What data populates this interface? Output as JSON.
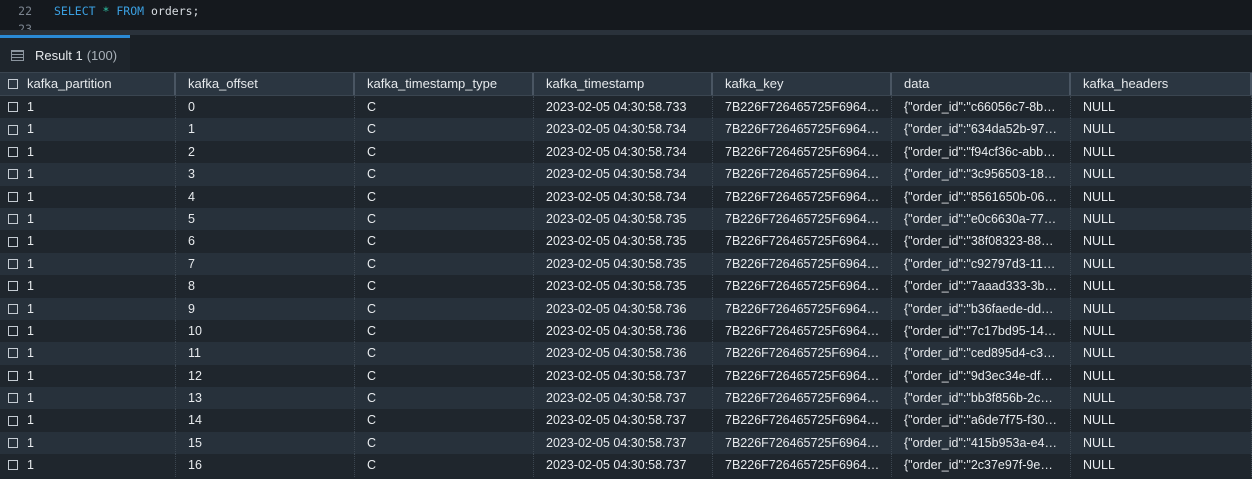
{
  "editor": {
    "lines": [
      {
        "number": "22",
        "tokens": [
          "SELECT",
          "*",
          "FROM",
          "orders;"
        ]
      },
      {
        "number": "23"
      }
    ]
  },
  "result_tab": {
    "label": "Result 1",
    "count": "(100)",
    "icon": "table-icon"
  },
  "grid": {
    "columns": [
      "kafka_partition",
      "kafka_offset",
      "kafka_timestamp_type",
      "kafka_timestamp",
      "kafka_key",
      "data",
      "kafka_headers"
    ],
    "rows": [
      [
        "1",
        "0",
        "C",
        "2023-02-05 04:30:58.733",
        "7B226F726465725F6964…",
        "{\"order_id\":\"c66056c7-8b…",
        "NULL"
      ],
      [
        "1",
        "1",
        "C",
        "2023-02-05 04:30:58.734",
        "7B226F726465725F6964…",
        "{\"order_id\":\"634da52b-97…",
        "NULL"
      ],
      [
        "1",
        "2",
        "C",
        "2023-02-05 04:30:58.734",
        "7B226F726465725F6964…",
        "{\"order_id\":\"f94cf36c-abb…",
        "NULL"
      ],
      [
        "1",
        "3",
        "C",
        "2023-02-05 04:30:58.734",
        "7B226F726465725F6964…",
        "{\"order_id\":\"3c956503-18…",
        "NULL"
      ],
      [
        "1",
        "4",
        "C",
        "2023-02-05 04:30:58.734",
        "7B226F726465725F6964…",
        "{\"order_id\":\"8561650b-06…",
        "NULL"
      ],
      [
        "1",
        "5",
        "C",
        "2023-02-05 04:30:58.735",
        "7B226F726465725F6964…",
        "{\"order_id\":\"e0c6630a-77…",
        "NULL"
      ],
      [
        "1",
        "6",
        "C",
        "2023-02-05 04:30:58.735",
        "7B226F726465725F6964…",
        "{\"order_id\":\"38f08323-88…",
        "NULL"
      ],
      [
        "1",
        "7",
        "C",
        "2023-02-05 04:30:58.735",
        "7B226F726465725F6964…",
        "{\"order_id\":\"c92797d3-11…",
        "NULL"
      ],
      [
        "1",
        "8",
        "C",
        "2023-02-05 04:30:58.735",
        "7B226F726465725F6964…",
        "{\"order_id\":\"7aaad333-3b…",
        "NULL"
      ],
      [
        "1",
        "9",
        "C",
        "2023-02-05 04:30:58.736",
        "7B226F726465725F6964…",
        "{\"order_id\":\"b36faede-dd…",
        "NULL"
      ],
      [
        "1",
        "10",
        "C",
        "2023-02-05 04:30:58.736",
        "7B226F726465725F6964…",
        "{\"order_id\":\"7c17bd95-14…",
        "NULL"
      ],
      [
        "1",
        "11",
        "C",
        "2023-02-05 04:30:58.736",
        "7B226F726465725F6964…",
        "{\"order_id\":\"ced895d4-c3…",
        "NULL"
      ],
      [
        "1",
        "12",
        "C",
        "2023-02-05 04:30:58.737",
        "7B226F726465725F6964…",
        "{\"order_id\":\"9d3ec34e-df…",
        "NULL"
      ],
      [
        "1",
        "13",
        "C",
        "2023-02-05 04:30:58.737",
        "7B226F726465725F6964…",
        "{\"order_id\":\"bb3f856b-2c…",
        "NULL"
      ],
      [
        "1",
        "14",
        "C",
        "2023-02-05 04:30:58.737",
        "7B226F726465725F6964…",
        "{\"order_id\":\"a6de7f75-f30…",
        "NULL"
      ],
      [
        "1",
        "15",
        "C",
        "2023-02-05 04:30:58.737",
        "7B226F726465725F6964…",
        "{\"order_id\":\"415b953a-e4…",
        "NULL"
      ],
      [
        "1",
        "16",
        "C",
        "2023-02-05 04:30:58.737",
        "7B226F726465725F6964…",
        "{\"order_id\":\"2c37e97f-9e…",
        "NULL"
      ]
    ]
  },
  "colors": {
    "accent": "#2a8ad6",
    "keyword": "#3a9fe0",
    "operator": "#2ec4a6"
  }
}
